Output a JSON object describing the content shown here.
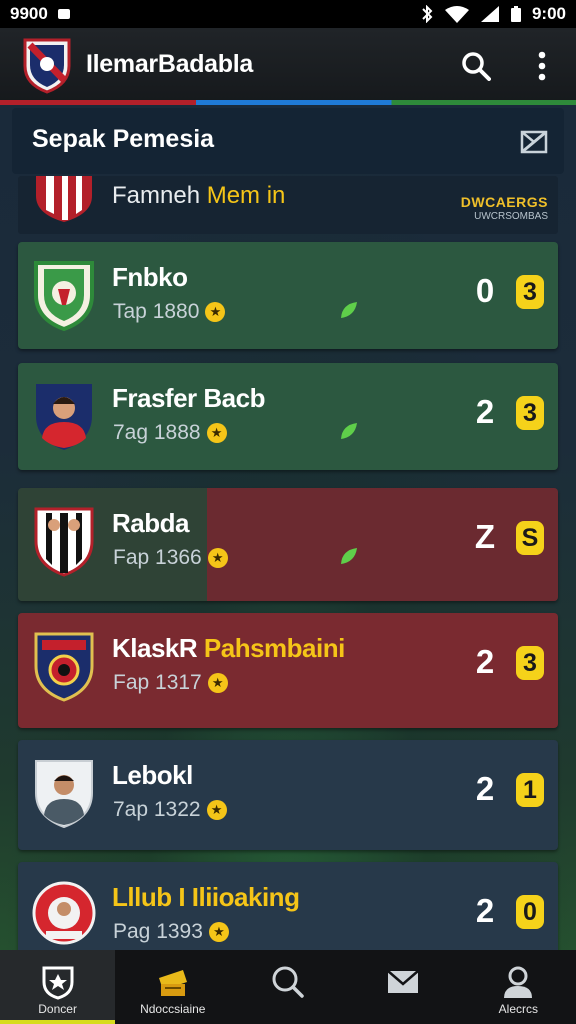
{
  "status": {
    "time_left": "9900",
    "time_right": "9:00"
  },
  "app": {
    "title": "IlemarBadabla"
  },
  "section": {
    "title": "Sepak Pemesia"
  },
  "header_row": {
    "name_prefix": "Famneh ",
    "name_highlight": "Mem in",
    "code_line1": "DWCAERGS",
    "code_line2": "UWCRSOMBAS"
  },
  "teams": [
    {
      "name": "Fnbko",
      "highlight": "",
      "meta": "Tap 1880",
      "score": "0",
      "pill": "3",
      "style": "green"
    },
    {
      "name": "Frasfer Bacb",
      "highlight": "",
      "meta": "7ag 1888",
      "score": "2",
      "pill": "3",
      "style": "green"
    },
    {
      "name": "Rabda",
      "highlight": "",
      "meta": "Fap 1366",
      "score": "Z",
      "pill": "S",
      "style": "split"
    },
    {
      "name": "KlaskR ",
      "highlight": "Pahsmbaini",
      "meta": "Fap 1317",
      "score": "2",
      "pill": "3",
      "style": "red"
    },
    {
      "name": "Lebokl",
      "highlight": "",
      "meta": "7ap 1322",
      "score": "2",
      "pill": "1",
      "style": "blue"
    },
    {
      "name": "",
      "highlight": "Lllub I Iliioaking",
      "meta": "Pag 1393",
      "score": "2",
      "pill": "0",
      "style": "blue"
    }
  ],
  "nav": [
    {
      "label": "Doncer",
      "icon": "shield-icon",
      "active": true
    },
    {
      "label": "Ndoccsiaine",
      "icon": "ticket-icon",
      "active": false
    },
    {
      "label": "",
      "icon": "search-icon",
      "active": false
    },
    {
      "label": "",
      "icon": "mail-icon",
      "active": false
    },
    {
      "label": "Alecrcs",
      "icon": "profile-icon",
      "active": false
    }
  ],
  "colors": {
    "accent": "#f5c518",
    "green_card": "#2c5840",
    "red_card": "#7a2a30",
    "blue_card": "#27394a",
    "nav_active": "#d7dc1d"
  }
}
